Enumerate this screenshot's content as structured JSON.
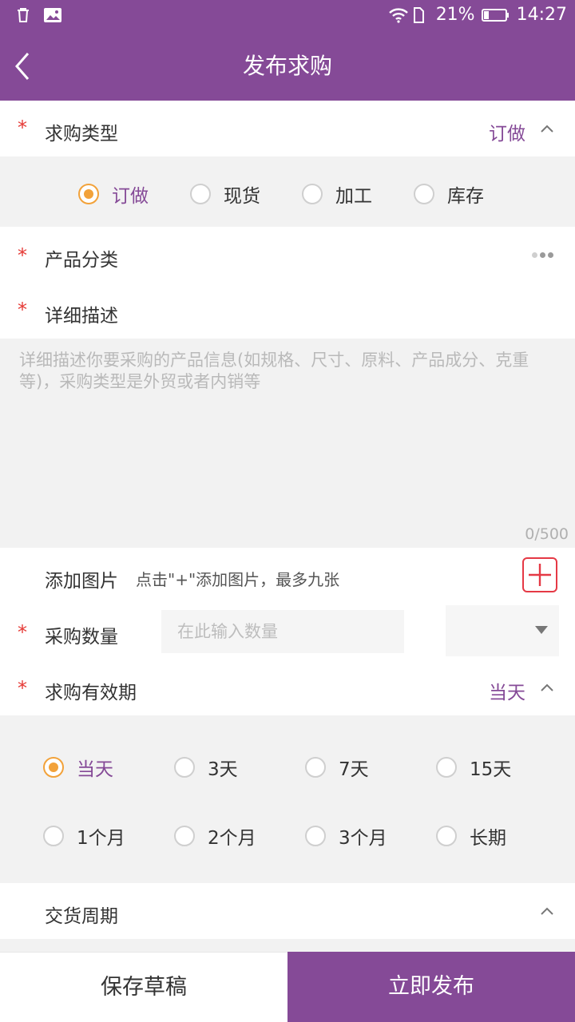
{
  "status_bar": {
    "battery_percent": "21%",
    "time": "14:27",
    "left_icons": [
      "trash-icon",
      "image-icon"
    ],
    "right_icons": [
      "wifi-icon",
      "sim-icon",
      "battery-icon"
    ]
  },
  "header": {
    "title": "发布求购",
    "back_icon": "chevron-left-icon"
  },
  "purchase_type": {
    "label": "求购类型",
    "value": "订做",
    "required_mark": "*",
    "options": [
      {
        "label": "订做",
        "selected": true
      },
      {
        "label": "现货",
        "selected": false
      },
      {
        "label": "加工",
        "selected": false
      },
      {
        "label": "库存",
        "selected": false
      }
    ]
  },
  "product_category": {
    "label": "产品分类",
    "required_mark": "*"
  },
  "description": {
    "label": "详细描述",
    "required_mark": "*",
    "placeholder": "详细描述你要采购的产品信息(如规格、尺寸、原料、产品成分、克重等)，采购类型是外贸或者内销等",
    "counter": "0/500"
  },
  "add_image": {
    "label": "添加图片",
    "hint": "点击\"+\"添加图片，最多九张"
  },
  "quantity": {
    "label": "采购数量",
    "required_mark": "*",
    "placeholder": "在此输入数量",
    "unit_value": ""
  },
  "validity": {
    "label": "求购有效期",
    "value": "当天",
    "required_mark": "*",
    "options": [
      {
        "label": "当天",
        "selected": true
      },
      {
        "label": "3天",
        "selected": false
      },
      {
        "label": "7天",
        "selected": false
      },
      {
        "label": "15天",
        "selected": false
      },
      {
        "label": "1个月",
        "selected": false
      },
      {
        "label": "2个月",
        "selected": false
      },
      {
        "label": "3个月",
        "selected": false
      },
      {
        "label": "长期",
        "selected": false
      }
    ]
  },
  "delivery_cycle": {
    "label": "交货周期"
  },
  "footer": {
    "save_label": "保存草稿",
    "publish_label": "立即发布"
  },
  "colors": {
    "brand": "#854a97",
    "radio_accent": "#f2a23a",
    "required": "#e53935"
  }
}
